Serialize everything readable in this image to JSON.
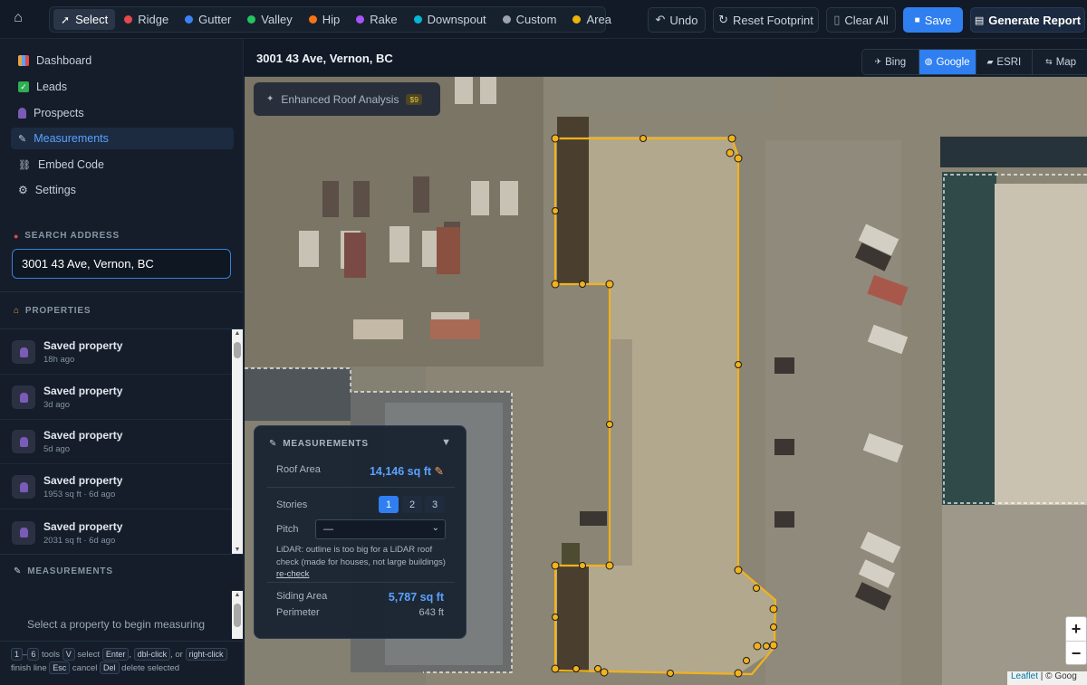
{
  "toolbar": {
    "tools": [
      {
        "label": "Select",
        "color": "#ffffff"
      },
      {
        "label": "Ridge",
        "color": "#e5484d"
      },
      {
        "label": "Gutter",
        "color": "#3b82f6"
      },
      {
        "label": "Valley",
        "color": "#22c55e"
      },
      {
        "label": "Hip",
        "color": "#f97316"
      },
      {
        "label": "Rake",
        "color": "#a855f7"
      },
      {
        "label": "Downspout",
        "color": "#06b6d4"
      },
      {
        "label": "Custom",
        "color": "#9ca3af"
      },
      {
        "label": "Area",
        "color": "#eab308"
      }
    ],
    "undo": "Undo",
    "reset": "Reset Footprint",
    "clear": "Clear All",
    "save": "Save",
    "report": "Generate Report"
  },
  "sidebar": {
    "nav": [
      {
        "label": "Dashboard",
        "icon": "bar-chart-icon"
      },
      {
        "label": "Leads",
        "icon": "check-icon"
      },
      {
        "label": "Prospects",
        "icon": "person-icon"
      },
      {
        "label": "Measurements",
        "icon": "ruler-icon"
      },
      {
        "label": "Embed Code",
        "icon": "link-icon"
      },
      {
        "label": "Settings",
        "icon": "gear-icon"
      }
    ],
    "search_label": "SEARCH ADDRESS",
    "search_value": "3001 43 Ave, Vernon, BC",
    "properties_label": "PROPERTIES",
    "properties": [
      {
        "title": "Saved property",
        "sub": "18h ago"
      },
      {
        "title": "Saved property",
        "sub": "3d ago"
      },
      {
        "title": "Saved property",
        "sub": "5d ago"
      },
      {
        "title": "Saved property",
        "sub": "1953 sq ft · 6d ago"
      },
      {
        "title": "Saved property",
        "sub": "2031 sq ft · 6d ago"
      }
    ],
    "measurements_label": "MEASUREMENTS",
    "empty_hint": "Select a property to begin measuring",
    "shortcuts": {
      "k1": "1",
      "dash": "–",
      "k6": "6",
      "tools": "tools",
      "kV": "V",
      "select": "select",
      "kEnter": "Enter",
      "comma": ",",
      "kDbl": "dbl-click",
      "or": ", or",
      "kRight": "right-click",
      "finish": "finish line",
      "kEsc": "Esc",
      "cancel": "cancel",
      "kDel": "Del",
      "delete": "delete selected"
    }
  },
  "map": {
    "address": "3001 43 Ave, Vernon, BC",
    "layers": [
      {
        "label": "Bing",
        "active": false
      },
      {
        "label": "Google",
        "active": true
      },
      {
        "label": "ESRI",
        "active": false
      },
      {
        "label": "Map",
        "active": false
      }
    ],
    "enhanced_label": "Enhanced Roof Analysis",
    "enhanced_price": "$9",
    "attribution_link": "Leaflet",
    "attribution_text": " | © Goog",
    "zoom_in": "+",
    "zoom_out": "−"
  },
  "measurements": {
    "header": "MEASUREMENTS",
    "roof_area_label": "Roof Area",
    "roof_area_value": "14,146 sq ft",
    "stories_label": "Stories",
    "stories": [
      "1",
      "2",
      "3"
    ],
    "pitch_label": "Pitch",
    "pitch_value": "—",
    "lidar_text": "LiDAR: outline is too big for a LiDAR roof check (made for houses, not large buildings)",
    "recheck": "re-check",
    "siding_label": "Siding Area",
    "siding_value": "5,787 sq ft",
    "perimeter_label": "Perimeter",
    "perimeter_value": "643 ft"
  },
  "colors": {
    "accent": "#2f7ff0",
    "outline": "#f2b21c"
  }
}
